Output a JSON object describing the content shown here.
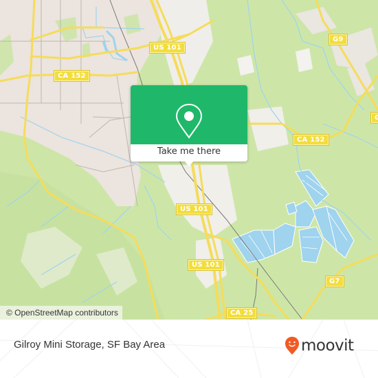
{
  "map": {
    "colors": {
      "land": "#cde6a8",
      "urban": "#ede6e1",
      "road_major": "#f5dc5a",
      "water": "#9fd3ee",
      "popup_green": "#1fb86a",
      "brand_orange": "#f15a24"
    },
    "road_labels": [
      {
        "id": "us101-north",
        "text": "US 101"
      },
      {
        "id": "ca152-west",
        "text": "CA 152"
      },
      {
        "id": "g9",
        "text": "G9"
      },
      {
        "id": "ca152-east",
        "text": "CA 152"
      },
      {
        "id": "g-cut",
        "text": "G"
      },
      {
        "id": "us101-mid",
        "text": "US 101"
      },
      {
        "id": "us101-south",
        "text": "US 101"
      },
      {
        "id": "g7",
        "text": "G7"
      },
      {
        "id": "ca25",
        "text": "CA 25"
      }
    ],
    "attribution": "© OpenStreetMap contributors"
  },
  "popup": {
    "icon": "map-pin-icon",
    "action_label": "Take me there"
  },
  "footer": {
    "place_name": "Gilroy Mini Storage, SF Bay Area",
    "brand": "moovit",
    "brand_icon": "moovit-pin-smile-icon"
  }
}
